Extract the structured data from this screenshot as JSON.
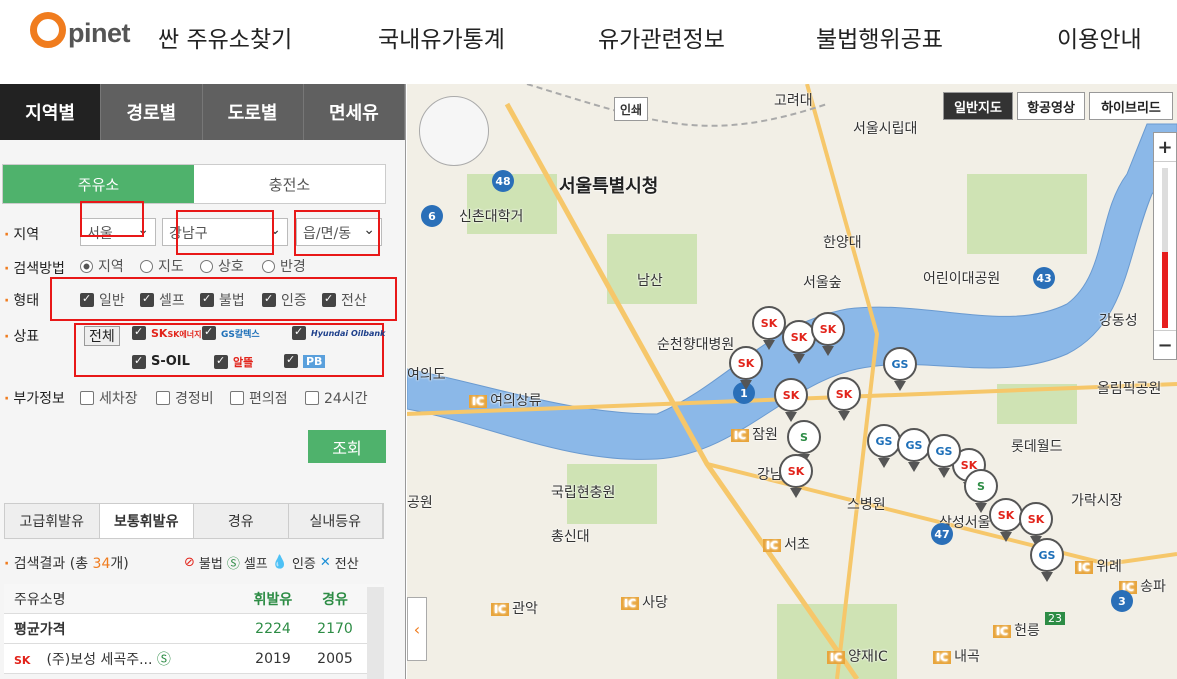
{
  "header": {
    "logo_letter": "O",
    "logo_text": "pinet",
    "logo_subtitle": "싼 주유소찾기",
    "nav": [
      "국내유가통계",
      "유가관련정보",
      "불법행위공표",
      "이용안내"
    ]
  },
  "left": {
    "main_tabs": [
      {
        "label": "지역별",
        "active": true
      },
      {
        "label": "경로별",
        "active": false
      },
      {
        "label": "도로별",
        "active": false
      },
      {
        "label": "면세유",
        "active": false
      }
    ],
    "sub_tabs": [
      {
        "label": "주유소",
        "active": true
      },
      {
        "label": "충전소",
        "active": false
      }
    ],
    "region": {
      "label": "지역",
      "sido": "서울",
      "sigungu": "강남구",
      "dong": "읍/면/동"
    },
    "search_method": {
      "label": "검색방법",
      "options": [
        {
          "label": "지역",
          "checked": true
        },
        {
          "label": "지도",
          "checked": false
        },
        {
          "label": "상호",
          "checked": false
        },
        {
          "label": "반경",
          "checked": false
        }
      ]
    },
    "type": {
      "label": "형태",
      "options": [
        {
          "label": "일반",
          "checked": true
        },
        {
          "label": "셀프",
          "checked": true
        },
        {
          "label": "불법",
          "checked": true
        },
        {
          "label": "인증",
          "checked": true
        },
        {
          "label": "전산",
          "checked": true
        }
      ]
    },
    "brand": {
      "label": "상표",
      "all_label": "전체",
      "brands": [
        "SK에너지",
        "GS칼텍스",
        "Hyundai Oilbank",
        "S-OIL",
        "알뜰",
        "PB"
      ]
    },
    "extra": {
      "label": "부가정보",
      "options": [
        {
          "label": "세차장",
          "checked": false
        },
        {
          "label": "경정비",
          "checked": false
        },
        {
          "label": "편의점",
          "checked": false
        },
        {
          "label": "24시간",
          "checked": false
        }
      ]
    },
    "search_button": "조회",
    "fuel_tabs": [
      {
        "label": "고급휘발유",
        "active": false
      },
      {
        "label": "보통휘발유",
        "active": true
      },
      {
        "label": "경유",
        "active": false
      },
      {
        "label": "실내등유",
        "active": false
      }
    ],
    "result": {
      "prefix": "검색결과 (총 ",
      "count": "34",
      "suffix": "개)"
    },
    "legend": [
      "불법",
      "셀프",
      "인증",
      "전산"
    ],
    "table": {
      "headers": [
        "주유소명",
        "휘발유",
        "경유"
      ],
      "average": {
        "name": "평균가격",
        "gasoline": "2224",
        "diesel": "2170"
      },
      "rows": [
        {
          "brand": "SK",
          "name": "(주)보성 세곡주...",
          "gasoline": "2019",
          "diesel": "2005"
        }
      ]
    }
  },
  "map": {
    "print_button": "인쇄",
    "map_types": [
      {
        "label": "일반지도",
        "active": true
      },
      {
        "label": "항공영상",
        "active": false
      },
      {
        "label": "하이브리드",
        "active": false
      }
    ],
    "zoom_in": "+",
    "zoom_out": "−",
    "labels": {
      "seoul_city_hall": "서울특별시청",
      "korea_univ": "고려대",
      "seoul_sirip": "서울시립대",
      "sinchon": "신촌대학거",
      "hanyang": "한양대",
      "namsan": "남산",
      "seoul_forest": "서울숲",
      "children_park": "어린이대공원",
      "suncheonhyang": "순천향대병원",
      "yeouido": "여의도",
      "yeouido_ramp": "여의상류",
      "jamwon": "잠원",
      "lotte_world": "롯데월드",
      "gangdong": "강동성",
      "olympic_park": "올림픽공원",
      "national_cemetery": "국립현충원",
      "chongsin": "총신대",
      "samsung_seoul": "삼성서울",
      "garak": "가락시장",
      "seocho": "서초",
      "gwanak": "관악",
      "sadang": "사당",
      "yangjae_ic": "양재IC",
      "naegok": "내곡",
      "heolleung": "헌릉",
      "wirye": "위례",
      "songpa": "송파",
      "gangnam": "강남",
      "western_park": "공원",
      "hospital": "스병원"
    },
    "ic": "IC",
    "route_numbers": [
      "48",
      "6",
      "43",
      "47",
      "3",
      "1"
    ],
    "route_23": "23",
    "pins": [
      "SK",
      "SK",
      "SK",
      "SK",
      "GS",
      "SK",
      "S",
      "SK",
      "GS",
      "SK",
      "SK",
      "GS",
      "GS",
      "S",
      "SK",
      "SK",
      "GS"
    ]
  }
}
